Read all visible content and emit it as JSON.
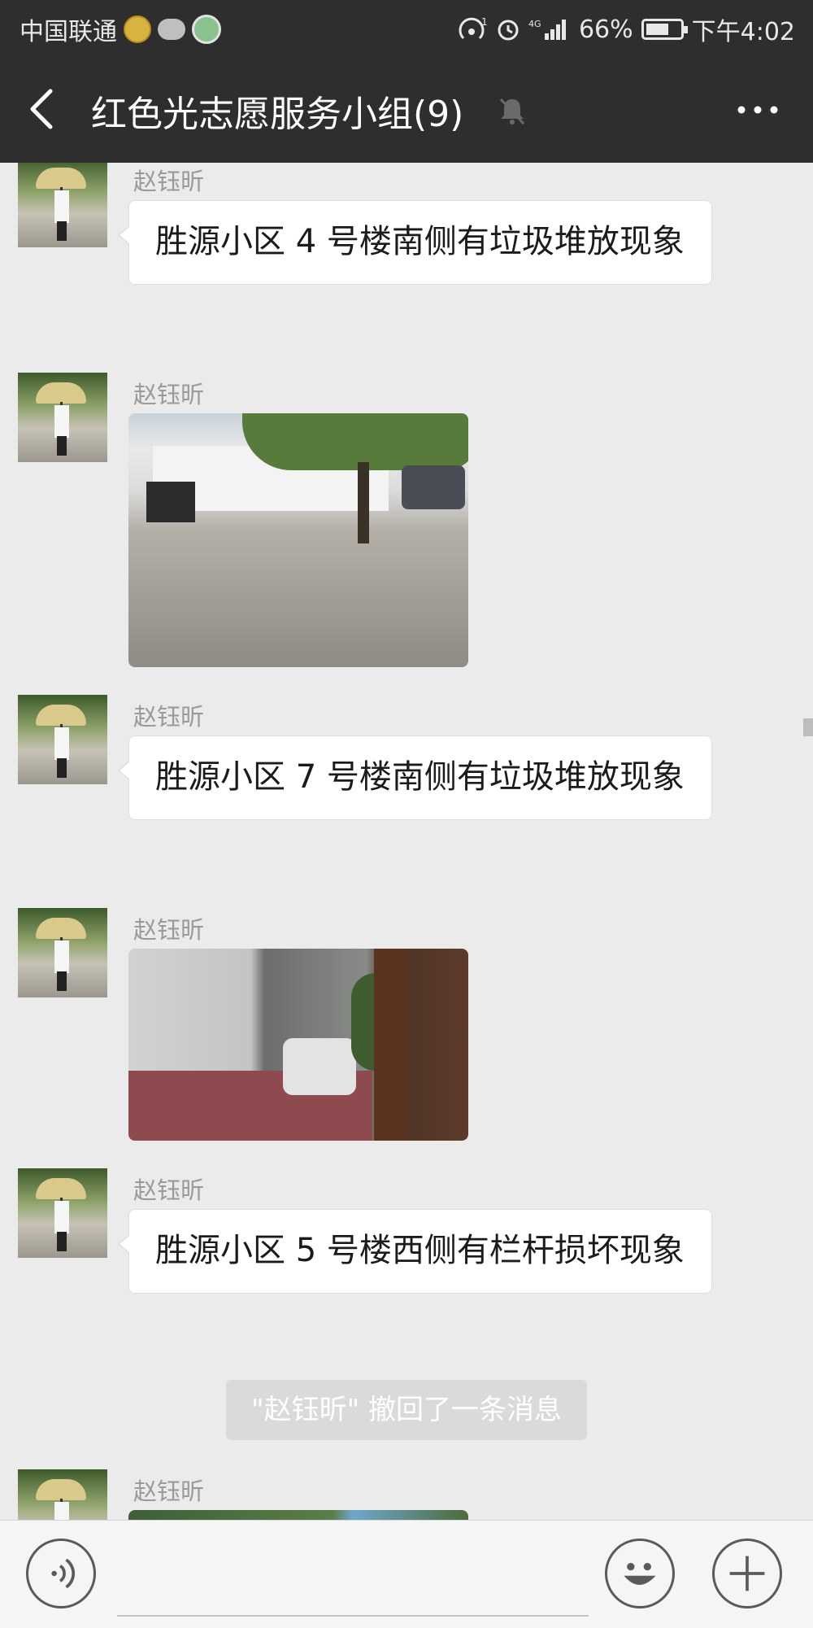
{
  "status_bar": {
    "carrier": "中国联通",
    "battery_percent": "66%",
    "time": "下午4:02"
  },
  "header": {
    "title": "红色光志愿服务小组(9)",
    "back_icon": "chevron-left-icon",
    "mute_icon": "bell-muted-icon",
    "more_icon": "more-dots-icon"
  },
  "messages": [
    {
      "type": "text",
      "sender": "赵钰昕",
      "text": "胜源小区 4 号楼南侧有垃圾堆放现象"
    },
    {
      "type": "image",
      "sender": "赵钰昕"
    },
    {
      "type": "text",
      "sender": "赵钰昕",
      "text": "胜源小区 7 号楼南侧有垃圾堆放现象"
    },
    {
      "type": "image",
      "sender": "赵钰昕"
    },
    {
      "type": "text",
      "sender": "赵钰昕",
      "text": "胜源小区 5 号楼西侧有栏杆损坏现象"
    },
    {
      "type": "system",
      "text": "\"赵钰昕\" 撤回了一条消息"
    },
    {
      "type": "image",
      "sender": "赵钰昕"
    }
  ],
  "input_bar": {
    "voice_icon": "voice-icon",
    "emoji_icon": "emoji-icon",
    "plus_icon": "plus-icon",
    "input_value": ""
  },
  "colors": {
    "header_bg": "#2e2e2e",
    "chat_bg": "#ebebeb",
    "bubble_bg": "#ffffff",
    "system_tip_bg": "#dadada"
  }
}
